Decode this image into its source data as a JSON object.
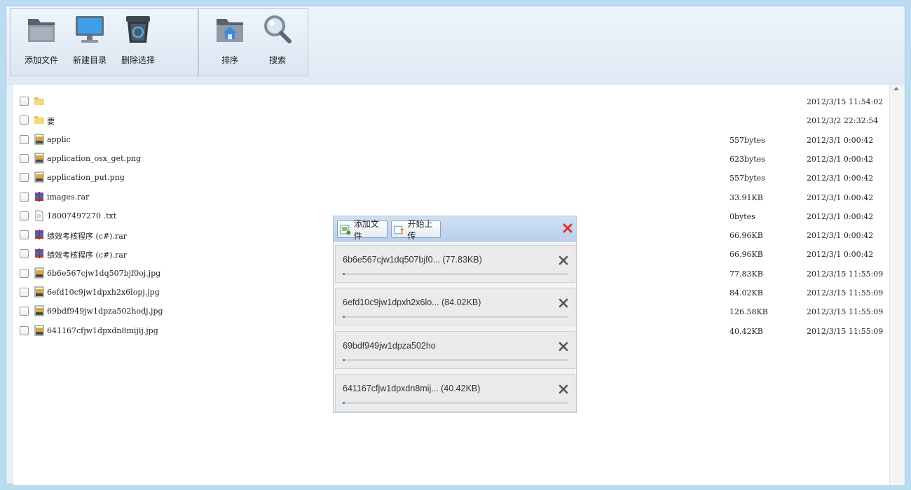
{
  "toolbar": {
    "add_file": "添加文件",
    "new_dir": "新建目录",
    "delete_selected": "删除选择",
    "sort": "排序",
    "search": "搜索"
  },
  "files": [
    {
      "name": "",
      "size": "",
      "date": "2012/3/15 11:54:02",
      "icon": "folder-icon"
    },
    {
      "name": "要",
      "size": "",
      "date": "2012/3/2 22:32:54",
      "icon": "folder-icon"
    },
    {
      "name": "applic",
      "size": "557bytes",
      "date": "2012/3/1 0:00:42",
      "icon": "image-file-icon"
    },
    {
      "name": "application_osx_get.png",
      "size": "623bytes",
      "date": "2012/3/1 0:00:42",
      "icon": "image-file-icon"
    },
    {
      "name": "application_put.png",
      "size": "557bytes",
      "date": "2012/3/1 0:00:42",
      "icon": "image-file-icon"
    },
    {
      "name": "images.rar",
      "size": "33.91KB",
      "date": "2012/3/1 0:00:42",
      "icon": "rar-file-icon"
    },
    {
      "name": "18007497270 .txt",
      "size": "0bytes",
      "date": "2012/3/1 0:00:42",
      "icon": "text-file-icon"
    },
    {
      "name": "绩效考核程序 (c#).rar",
      "size": "66.96KB",
      "date": "2012/3/1 0:00:42",
      "icon": "rar-file-icon"
    },
    {
      "name": "绩效考核程序 (c#).rar",
      "size": "66.96KB",
      "date": "2012/3/1 0:00:42",
      "icon": "rar-file-icon"
    },
    {
      "name": "6b6e567cjw1dq507bjf0oj.jpg",
      "size": "77.83KB",
      "date": "2012/3/15 11:55:09",
      "icon": "image-file-icon"
    },
    {
      "name": "6efd10c9jw1dpxh2x6lopj.jpg",
      "size": "84.02KB",
      "date": "2012/3/15 11:55:09",
      "icon": "image-file-icon"
    },
    {
      "name": "69bdf949jw1dpza502hodj.jpg",
      "size": "126.58KB",
      "date": "2012/3/15 11:55:09",
      "icon": "image-file-icon"
    },
    {
      "name": "641167cfjw1dpxdn8mijij.jpg",
      "size": "40.42KB",
      "date": "2012/3/15 11:55:09",
      "icon": "image-file-icon"
    }
  ],
  "upload": {
    "add_file": "添加文件",
    "start_upload": "开始上传",
    "queue": [
      {
        "label": "6b6e567cjw1dq507bjf0... (77.83KB)",
        "progress": 0.01
      },
      {
        "label": "6efd10c9jw1dpxh2x6lo... (84.02KB)",
        "progress": 0.01
      },
      {
        "label": "69bdf949jw1dpza502ho",
        "progress": 0.01
      },
      {
        "label": "641167cfjw1dpxdn8mij... (40.42KB)",
        "progress": 0.01
      }
    ]
  },
  "colors": {
    "dialog_header": "#b8d0ea",
    "progress": "#3d8ee0",
    "close_red": "#e0302b"
  }
}
